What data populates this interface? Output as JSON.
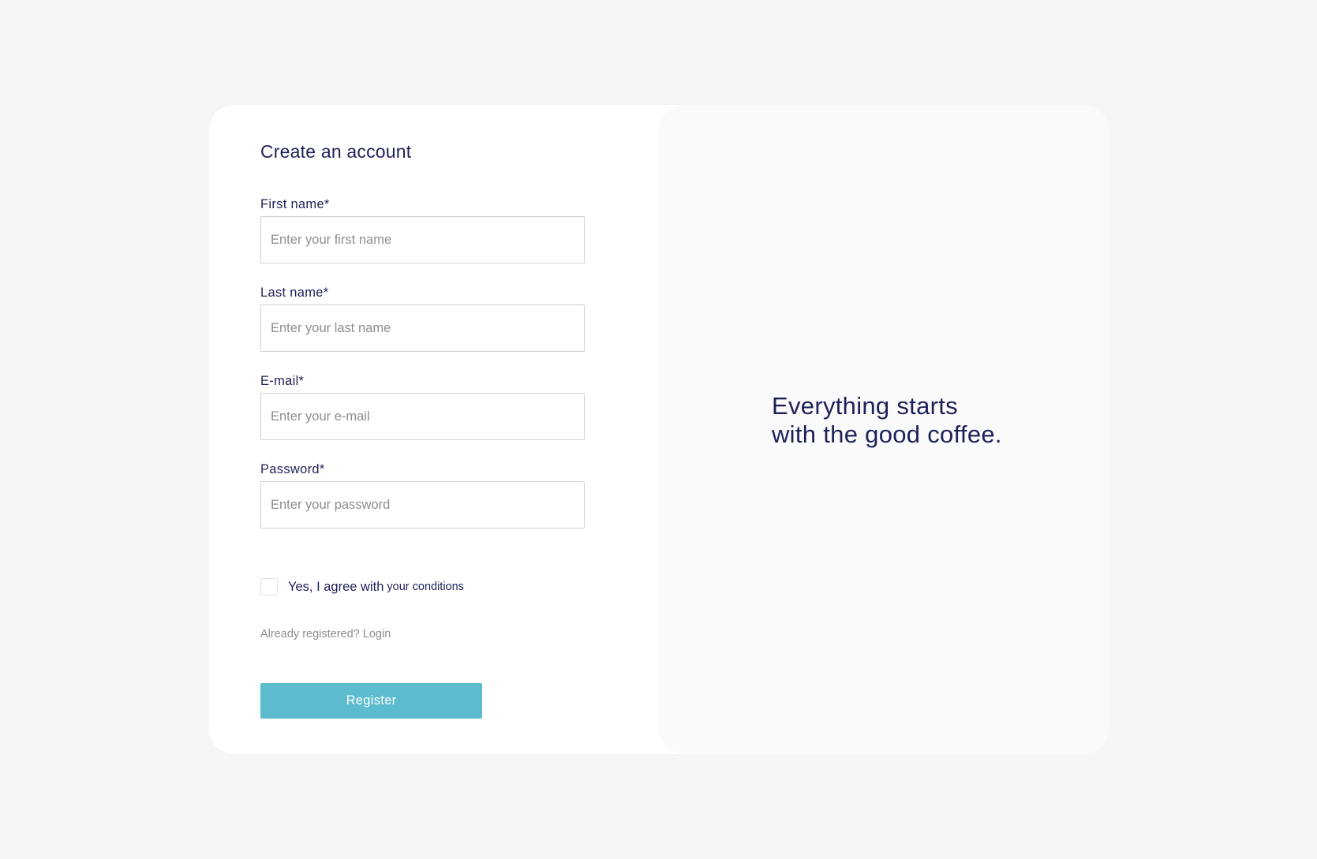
{
  "form": {
    "title": "Create an account",
    "fields": [
      {
        "label": "First name*",
        "placeholder": "Enter your first name",
        "value": ""
      },
      {
        "label": "Last name*",
        "placeholder": "Enter your last name",
        "value": ""
      },
      {
        "label": "E-mail*",
        "placeholder": "Enter your e-mail",
        "value": ""
      },
      {
        "label": "Password*",
        "placeholder": "Enter your password",
        "value": ""
      }
    ],
    "agree": {
      "checked": false,
      "text": "Yes, I agree with",
      "link": "your conditions"
    },
    "login": {
      "text": "Already registered?",
      "link": "Login"
    },
    "register_label": "Register"
  },
  "side": {
    "tagline": "Everything starts with the good coffee."
  },
  "colors": {
    "page_background": "#f6f6f6",
    "card": "#ffffff",
    "side_panel": "#fafafa",
    "text_primary": "#1d2158",
    "text_muted": "#8d8d94",
    "accent": "#5dbbce",
    "input_border": "#d2d2d6"
  }
}
